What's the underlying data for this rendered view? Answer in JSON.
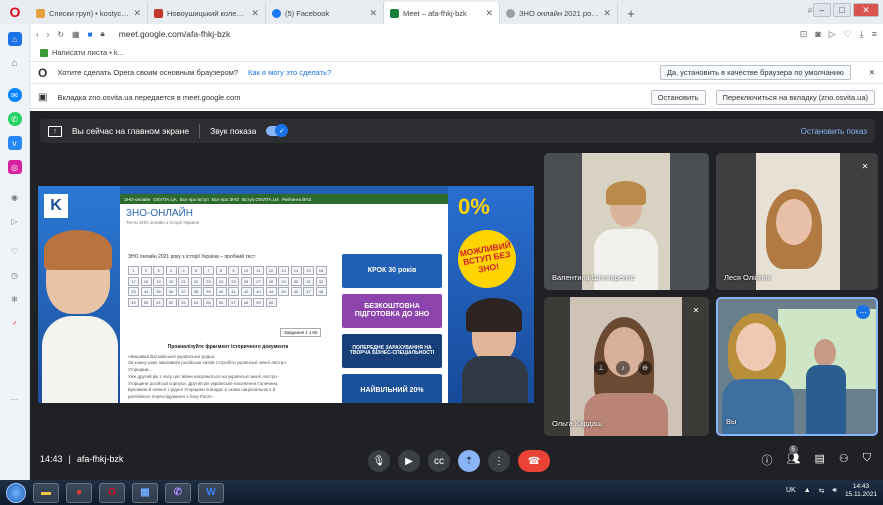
{
  "tabs": [
    {
      "label": "Списки груп) • kostycheva",
      "icon_color": "#e6a23c",
      "active": false
    },
    {
      "label": "Новоушицький коледж П",
      "icon_color": "#c0392b",
      "active": false
    },
    {
      "label": "(5) Facebook",
      "icon_color": "#1877f2",
      "active": false
    },
    {
      "label": "Meet – afa-fhkj-bzk",
      "icon_color": "#188038",
      "active": true
    },
    {
      "label": "ЗНО онлайн 2021 року з",
      "icon_color": "#9aa0a6",
      "active": false
    }
  ],
  "address": {
    "url": "meet.google.com/afa-fhkj-bzk"
  },
  "bookmark": {
    "label": "Написати листа • k..."
  },
  "infobar_default": {
    "text": "Хотите сделать Opera своим основным браузером?",
    "link": "Как я могу это сделать?",
    "button": "Да, установить в качестве браузера по умолчанию"
  },
  "infobar_share": {
    "text": "Вкладка zno.osvita.ua передается в meet.google.com",
    "stop_button": "Остановить",
    "switch_button": "Переключиться на вкладку (zno.osvita.ua)"
  },
  "share_bar": {
    "presenting_label": "Вы сейчас на главном экране",
    "sound_label": "Звук показа",
    "stop_label": "Остановить показ"
  },
  "presentation": {
    "site_title": "ЗНО-ОНЛАЙН",
    "site_subtitle": "Тести ЗНО онлайн з історії України",
    "nav_items": [
      "ЗНО-онлайн",
      "OSVITA.UA",
      "Все про вступ",
      "Все про ЗНО",
      "Вступ.OSVITA.UA",
      "Рейтинги ВНЗ"
    ],
    "test_heading": "ЗНО онлайн 2021 року з історії України – пробний тест",
    "question_numbers": [
      "1",
      "2",
      "3",
      "4",
      "5",
      "6",
      "7",
      "8",
      "9",
      "10",
      "11",
      "12",
      "13",
      "14",
      "15",
      "16",
      "17",
      "18",
      "19",
      "20",
      "21",
      "22",
      "23",
      "24",
      "25",
      "26",
      "27",
      "28",
      "29",
      "30",
      "31",
      "32",
      "33",
      "34",
      "35",
      "36",
      "37",
      "38",
      "39",
      "40",
      "41",
      "42",
      "43",
      "44",
      "45",
      "46",
      "47",
      "48",
      "49",
      "50",
      "51",
      "52",
      "53",
      "54",
      "55",
      "56",
      "57",
      "58",
      "59",
      "60"
    ],
    "task_label": "Завдання 1 з 60",
    "text_heading": "Проаналізуйте фрагмент історичного документа",
    "text_lines": [
      "«Вишивка Батьківської української родьи.",
      "За кожну шию зваливати російськи хатків сотробіти українські землі Австро-",
      "Угорщини...",
      "Уже другий рік з часу цієї війни насуваються на українські землі Австро-",
      "Угорщини російські корпуси. Другий рік українське населення Галичини,",
      "Буковини й певної з рідної Угорщини попадає в окова національного й",
      "релігійного переслідування з боку Росії»."
    ],
    "ads": [
      {
        "text": "КРОК 30 років",
        "color": "#1f5fb4"
      },
      {
        "text": "БЕЗКОШТОВНА ПІДГОТОВКА ДО ЗНО",
        "color": "#8e44ad"
      },
      {
        "text": "ПОПЕРЕДНЄ ЗАРАХУВАННЯ НА ТВОРЧА БІЗНЕС-СПЕЦІАЛЬНОСТІ",
        "color": "#17407a"
      },
      {
        "text": "НАЙВІЛЬНИЙ 20%",
        "color": "#1a4f99"
      }
    ],
    "promo_percent": "0%",
    "promo_badge": "МОЖЛИВИЙ ВСТУП БЕЗ ЗНО!"
  },
  "participants": [
    {
      "name": "Валентина Шинкаренко",
      "muted": false
    },
    {
      "name": "Леся Олійник",
      "muted": true
    },
    {
      "name": "Ольга Кардаш",
      "muted": true
    },
    {
      "name": "Вы",
      "muted": false
    }
  ],
  "meeting": {
    "time": "14:43",
    "separator": "|",
    "code": "afa-fhkj-bzk",
    "people_count": "5"
  },
  "taskbar": {
    "lang": "UK",
    "time": "14:43",
    "date": "15.11.2021"
  }
}
